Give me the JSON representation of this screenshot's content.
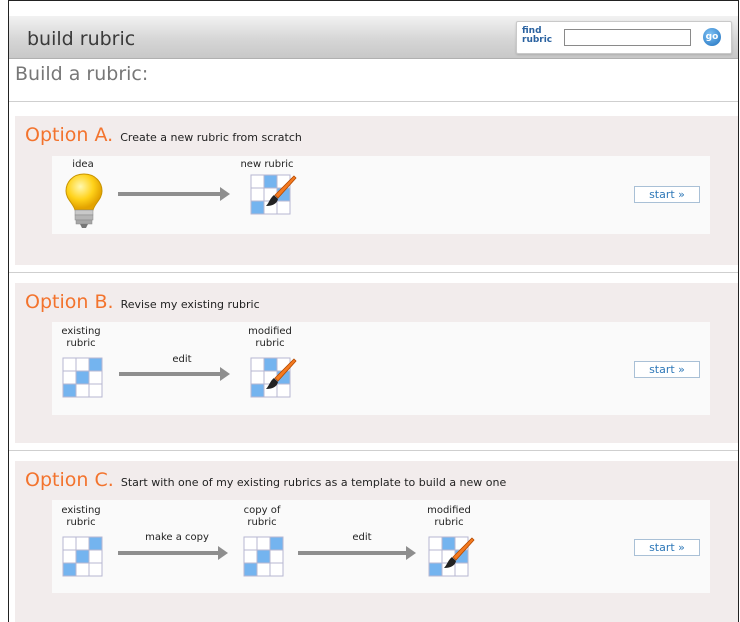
{
  "header": {
    "title": "build rubric",
    "find_label": "find rubric",
    "search_value": "",
    "go_label": "go"
  },
  "page": {
    "heading": "Build a rubric:"
  },
  "options": {
    "a": {
      "letter": "Option A.",
      "description": "Create a new rubric from scratch",
      "labels": [
        "idea",
        "new rubric"
      ],
      "start": "start »"
    },
    "b": {
      "letter": "Option B.",
      "description": "Revise my existing rubric",
      "labels": [
        "existing rubric",
        "edit",
        "modified rubric"
      ],
      "start": "start »"
    },
    "c": {
      "letter": "Option C.",
      "description": "Start with one of my existing rubrics as a template to build a new one",
      "labels": [
        "existing rubric",
        "make a copy",
        "copy of rubric",
        "edit",
        "modified rubric"
      ],
      "start": "start »"
    }
  },
  "colors": {
    "accent": "#f3732d",
    "link": "#2e78b8",
    "grid_blue": "#74b4ef"
  },
  "icons": [
    "lightbulb-icon",
    "rubric-grid-icon",
    "paintbrush-icon",
    "arrow-right-icon"
  ]
}
